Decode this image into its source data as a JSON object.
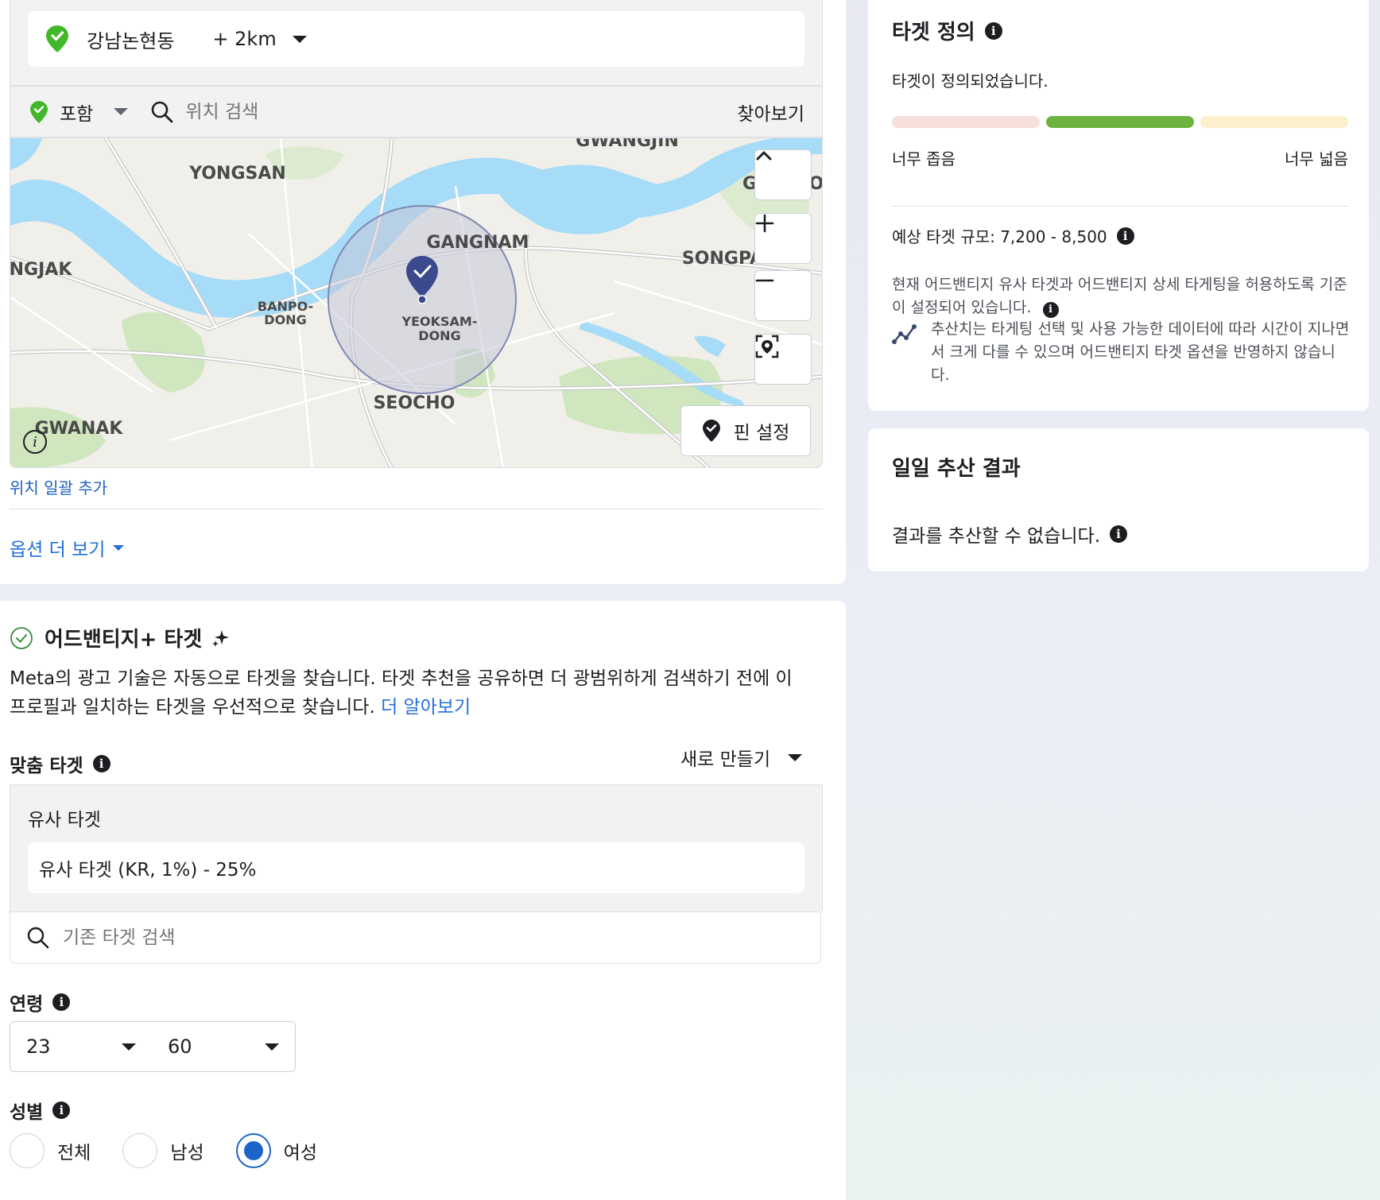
{
  "location": {
    "name": "강남논현동",
    "radius": "+ 2km",
    "include_label": "포함",
    "search_placeholder": "위치 검색",
    "browse_label": "찾아보기",
    "bulk_add_label": "위치 일괄 추가",
    "more_options_label": "옵션 더 보기"
  },
  "map": {
    "labels": [
      {
        "text": "GWANGJIN"
      },
      {
        "text": "YONGSAN"
      },
      {
        "text": "GANGNAM"
      },
      {
        "text": "SONGPA"
      },
      {
        "text": "NGJAK"
      },
      {
        "text": "BANPO-"
      },
      {
        "text": "DONG"
      },
      {
        "text": "YEOKSAM-"
      },
      {
        "text": "DONG"
      },
      {
        "text": "SEOCHO"
      },
      {
        "text": "GWANAK"
      },
      {
        "text": "G"
      },
      {
        "text": "O"
      }
    ],
    "pin_button_label": "핀 설정",
    "colors": {
      "water": "#a6dcf7",
      "land": "#f1efe9",
      "park": "#cfe6bf",
      "radius_fill": "#c4c7d8",
      "pin": "#3b4a8c"
    }
  },
  "advantage": {
    "title": "어드밴티지+ 타겟",
    "description_1": "Meta의 광고 기술은 자동으로 타겟을 찾습니다. 타겟 추천을 공유하면 더 광범위하게 검색하기 전에 이",
    "description_2": "프로필과 일치하는 타겟을 우선적으로 찾습니다.",
    "learn_more": "더 알아보기"
  },
  "custom_audience": {
    "label": "맞춤 타겟",
    "create_new": "새로 만들기",
    "lookalike_title": "유사 타겟",
    "lookalike_value": "유사 타겟 (KR, 1%) - 25%",
    "search_placeholder": "기존 타겟 검색"
  },
  "age": {
    "label": "연령",
    "min": "23",
    "max": "60"
  },
  "gender": {
    "label": "성별",
    "options": [
      "전체",
      "남성",
      "여성"
    ],
    "selected": "여성"
  },
  "definition": {
    "title": "타겟 정의",
    "status": "타겟이 정의되었습니다.",
    "narrow_label": "너무 좁음",
    "broad_label": "너무 넓음",
    "meter_colors": [
      "#f7dfdb",
      "#6cb33f",
      "#fcefcc"
    ],
    "estimated_size": "예상 타겟 규모: 7,200 - 8,500",
    "note_1": "현재 어드밴티지 유사 타겟과 어드밴티지 상세 타게팅을 허용하도록 기준이 설정되어 있습니다.",
    "note_2": "추산치는 타게팅 선택 및 사용 가능한 데이터에 따라 시간이 지나면서 크게 다를 수 있으며 어드밴티지 타겟 옵션을 반영하지 않습니다."
  },
  "daily": {
    "title": "일일 추산 결과",
    "message": "결과를 추산할 수 없습니다."
  }
}
